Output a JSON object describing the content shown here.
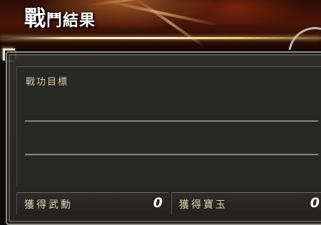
{
  "header": {
    "title_part1": "戰",
    "title_part2": "鬥結果"
  },
  "goals": {
    "title": "戰功目標"
  },
  "rewards": [
    {
      "label": "獲得武勳",
      "value": "0"
    },
    {
      "label": "獲得寶玉",
      "value": "0"
    }
  ],
  "colors": {
    "accent_gold": "#f0c870",
    "frame": "#8d8a84",
    "panel": "#282826",
    "label": "#d8c8a0"
  }
}
